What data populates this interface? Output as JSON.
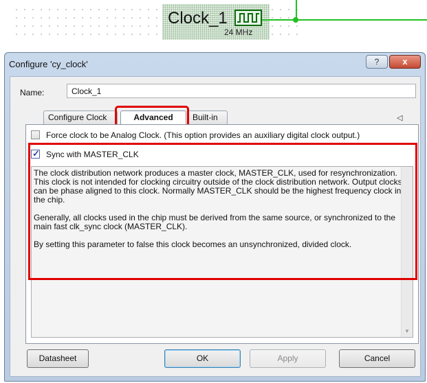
{
  "schematic": {
    "component_name": "Clock_1",
    "frequency": "24 MHz",
    "clock_symbol_icon": "square-wave-icon",
    "wire_color": "#21c021"
  },
  "dialog": {
    "title": "Configure 'cy_clock'",
    "help_label": "?",
    "close_label": "x",
    "name_label": "Name:",
    "name_value": "Clock_1",
    "tabs": [
      {
        "label": "Configure Clock",
        "active": false
      },
      {
        "label": "Advanced",
        "active": true
      },
      {
        "label": "Built-in",
        "active": false
      }
    ],
    "tab_scroll_arrows": "◁ ▷",
    "force_analog": {
      "label": "Force clock to be Analog Clock. (This option provides an auxiliary digital clock output.)",
      "checked": false
    },
    "sync_master": {
      "label": "Sync with MASTER_CLK",
      "checked": true
    },
    "description": {
      "p1": "The clock distribution network produces a master clock, MASTER_CLK, used for resynchronization. This clock is not intended for clocking circuitry outside of the clock distribution network. Output clocks can be phase aligned to this clock. Normally MASTER_CLK should be the highest frequency clock in the chip.",
      "p2": "Generally, all clocks used in the chip must be derived from the same source, or synchronized to the main fast clk_sync clock (MASTER_CLK).",
      "p3": "By setting this parameter to false this clock becomes an unsynchronized, divided clock."
    },
    "buttons": {
      "datasheet": "Datasheet",
      "ok": "OK",
      "apply": "Apply",
      "cancel": "Cancel"
    },
    "highlight_color": "#e00000"
  }
}
